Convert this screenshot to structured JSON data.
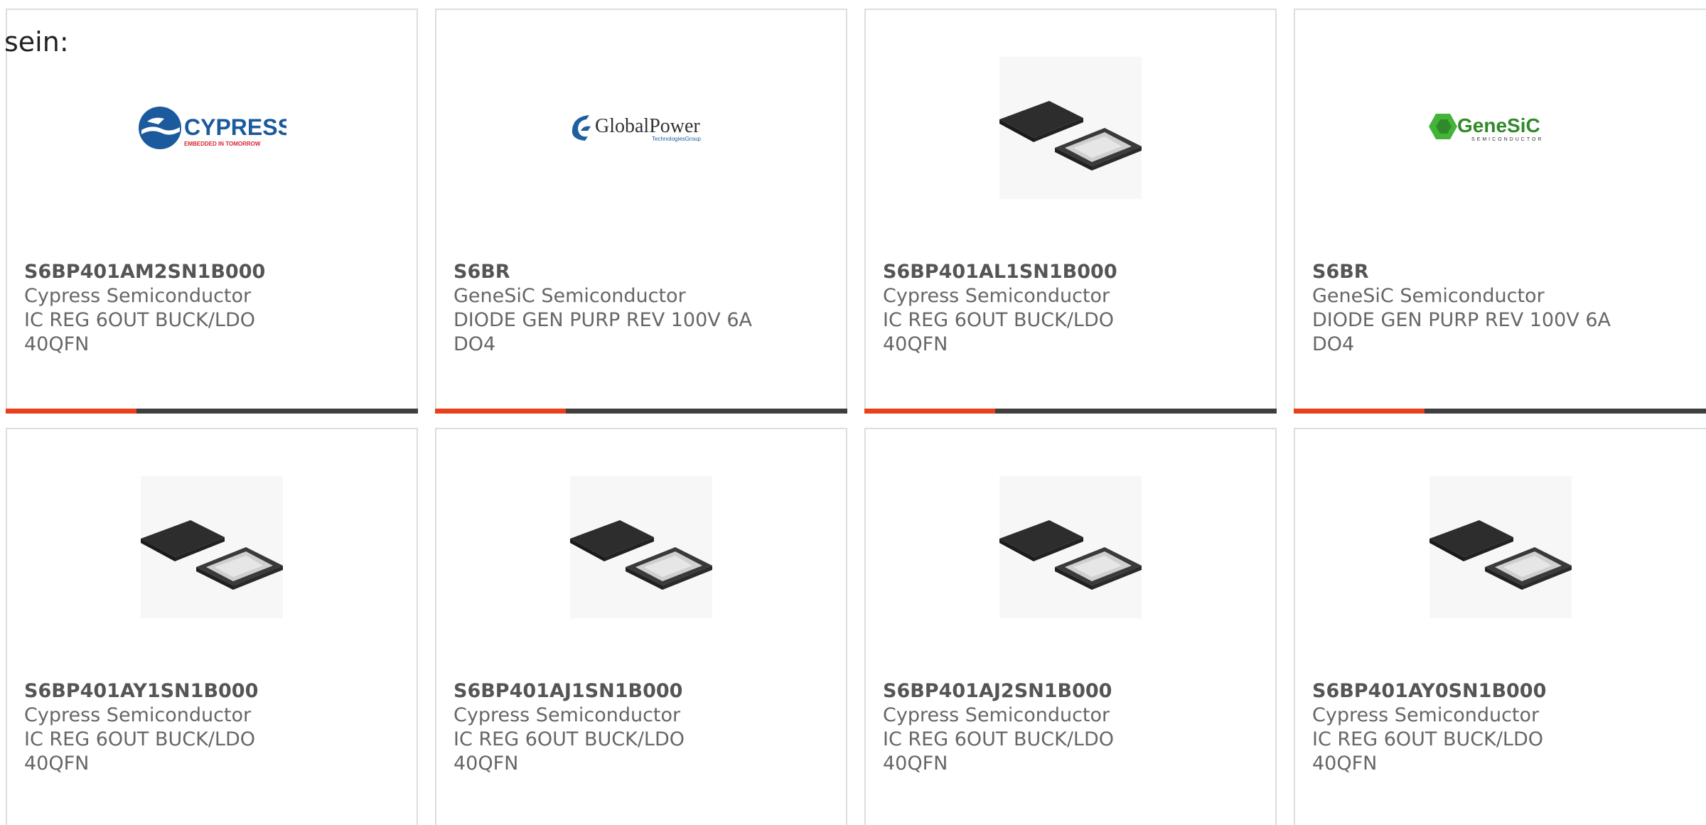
{
  "intro_text": "sein:",
  "products": [
    {
      "part": "S6BP401AM2SN1B000",
      "manufacturer": "Cypress Semiconductor",
      "description": "IC REG 6OUT BUCK/LDO 40QFN",
      "image": "cypress-logo"
    },
    {
      "part": "S6BR",
      "manufacturer": "GeneSiC Semiconductor",
      "description": "DIODE GEN PURP REV 100V 6A DO4",
      "image": "globalpower-logo"
    },
    {
      "part": "S6BP401AL1SN1B000",
      "manufacturer": "Cypress Semiconductor",
      "description": "IC REG 6OUT BUCK/LDO 40QFN",
      "image": "qfn-chip"
    },
    {
      "part": "S6BR",
      "manufacturer": "GeneSiC Semiconductor",
      "description": "DIODE GEN PURP REV 100V 6A DO4",
      "image": "genesic-logo"
    },
    {
      "part": "S6BP401AY1SN1B000",
      "manufacturer": "Cypress Semiconductor",
      "description": "IC REG 6OUT BUCK/LDO 40QFN",
      "image": "qfn-chip"
    },
    {
      "part": "S6BP401AJ1SN1B000",
      "manufacturer": "Cypress Semiconductor",
      "description": "IC REG 6OUT BUCK/LDO 40QFN",
      "image": "qfn-chip"
    },
    {
      "part": "S6BP401AJ2SN1B000",
      "manufacturer": "Cypress Semiconductor",
      "description": "IC REG 6OUT BUCK/LDO 40QFN",
      "image": "qfn-chip"
    },
    {
      "part": "S6BP401AY0SN1B000",
      "manufacturer": "Cypress Semiconductor",
      "description": "IC REG 6OUT BUCK/LDO 40QFN",
      "image": "qfn-chip"
    }
  ],
  "logos": {
    "cypress": {
      "name": "CYPRESS",
      "tagline": "EMBEDDED IN TOMORROW"
    },
    "globalpower": {
      "name": "GlobalPower",
      "tagline": "TechnologiesGroup"
    },
    "genesic": {
      "name": "GeneSiC",
      "tagline": "SEMICONDUCTOR"
    }
  },
  "colors": {
    "accent": "#e8401a",
    "bar": "#3f3f3f",
    "cypress_blue": "#1b5a9c",
    "cypress_red": "#d62631",
    "globalpower_blue": "#1e5f9e",
    "genesic_green": "#44b33a"
  }
}
